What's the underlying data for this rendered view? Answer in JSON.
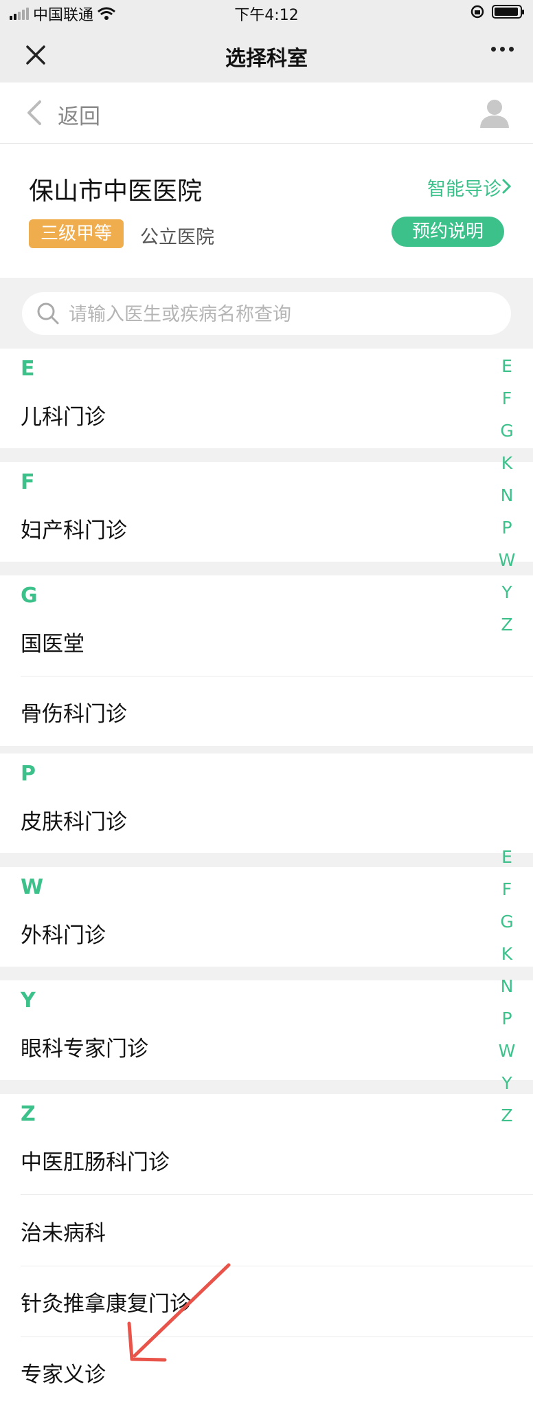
{
  "status_bar": {
    "carrier": "中国联通",
    "time": "下午4:12"
  },
  "nav": {
    "title": "选择科室"
  },
  "back": {
    "label": "返回"
  },
  "hospital": {
    "name": "保山市中医医院",
    "smart_guide": "智能导诊",
    "level_badge": "三级甲等",
    "type": "公立医院",
    "notice_button": "预约说明"
  },
  "search": {
    "placeholder": "请输入医生或疾病名称查询"
  },
  "sections": [
    {
      "letter": "E",
      "items": [
        "儿科门诊"
      ]
    },
    {
      "letter": "F",
      "items": [
        "妇产科门诊"
      ]
    },
    {
      "letter": "G",
      "items": [
        "国医堂",
        "骨伤科门诊"
      ]
    },
    {
      "letter": "P",
      "items": [
        "皮肤科门诊"
      ]
    },
    {
      "letter": "W",
      "items": [
        "外科门诊"
      ]
    },
    {
      "letter": "Y",
      "items": [
        "眼科专家门诊"
      ]
    },
    {
      "letter": "Z",
      "items": [
        "中医肛肠科门诊",
        "治未病科",
        "针灸推拿康复门诊",
        "专家义诊"
      ]
    }
  ],
  "index_letters": [
    "E",
    "F",
    "G",
    "K",
    "N",
    "P",
    "W",
    "Y",
    "Z"
  ],
  "colors": {
    "accent": "#3cc18b",
    "badge": "#f0ad4e",
    "annotation_arrow": "#e8534a"
  }
}
